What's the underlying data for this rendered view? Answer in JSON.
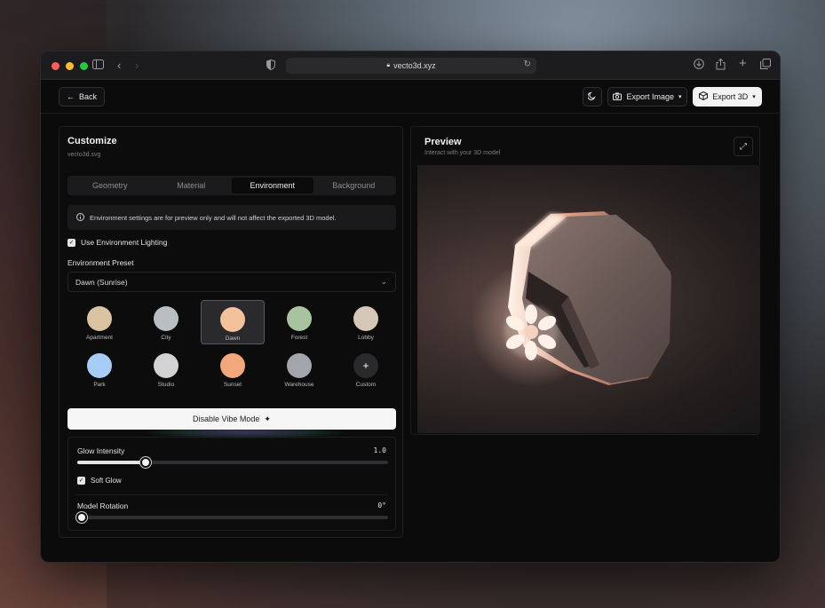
{
  "browser": {
    "url": "vecto3d.xyz",
    "icons": [
      "sidebar-icon",
      "back-arrow-icon",
      "forward-arrow-icon",
      "shield-icon",
      "lock-icon",
      "reload-icon",
      "download-icon",
      "share-icon",
      "new-tab-icon",
      "tabs-icon"
    ]
  },
  "header": {
    "back_label": "Back",
    "export_image_label": "Export Image",
    "export_3d_label": "Export 3D"
  },
  "customize": {
    "title": "Customize",
    "filename": "vecto3d.svg",
    "tabs": [
      {
        "label": "Geometry"
      },
      {
        "label": "Material"
      },
      {
        "label": "Environment",
        "active": true
      },
      {
        "label": "Background"
      }
    ],
    "info_text": "Environment settings are for preview only and will not affect the exported 3D model.",
    "use_env_lighting_label": "Use Environment Lighting",
    "use_env_lighting_checked": true,
    "preset_heading": "Environment Preset",
    "preset_value": "Dawn (Sunrise)",
    "presets": [
      {
        "label": "Apartment",
        "color": "#d9c3a0"
      },
      {
        "label": "City",
        "color": "#b9bec2"
      },
      {
        "label": "Dawn",
        "color": "#f3c29a",
        "selected": true
      },
      {
        "label": "Forest",
        "color": "#a8c49e"
      },
      {
        "label": "Lobby",
        "color": "#d5c8b8"
      },
      {
        "label": "Park",
        "color": "#a8cdf5"
      },
      {
        "label": "Studio",
        "color": "#d2d2d4"
      },
      {
        "label": "Sunset",
        "color": "#f3a87c"
      },
      {
        "label": "Warehouse",
        "color": "#a3a5ad"
      },
      {
        "label": "Custom",
        "color": "#2a2a2d",
        "symbol": "+"
      }
    ],
    "vibe_button_label": "Disable Vibe Mode",
    "glow_label": "Glow Intensity",
    "glow_value_text": "1.0",
    "glow_fraction": 0.22,
    "soft_glow_label": "Soft Glow",
    "soft_glow_checked": true,
    "rotation_label": "Model Rotation",
    "rotation_value_text": "0°",
    "rotation_fraction": 0.0
  },
  "preview": {
    "title": "Preview",
    "subtitle": "Interact with your 3D model"
  }
}
